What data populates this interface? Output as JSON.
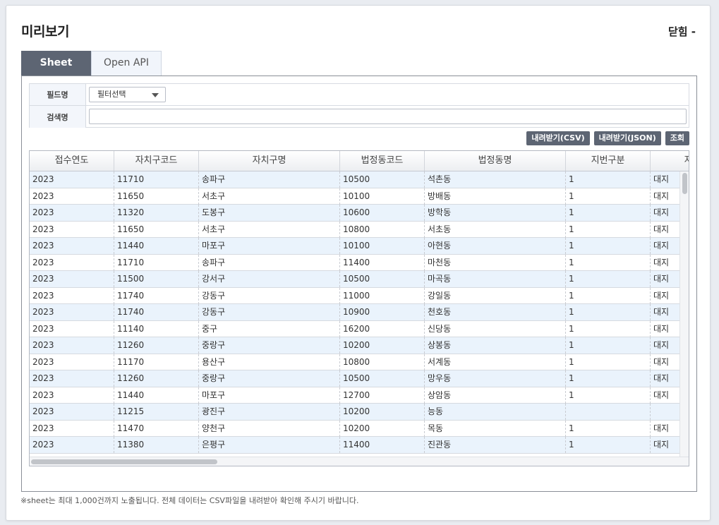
{
  "header": {
    "title": "미리보기",
    "close_label": "닫힘 -"
  },
  "tabs": [
    {
      "label": "Sheet",
      "active": true
    },
    {
      "label": "Open API",
      "active": false
    }
  ],
  "filter": {
    "field_label": "필드명",
    "field_select_value": "필터선택",
    "search_label": "검색명",
    "search_value": ""
  },
  "actions": {
    "csv_label": "내려받기(CSV)",
    "json_label": "내려받기(JSON)",
    "query_label": "조회"
  },
  "grid": {
    "columns": [
      "접수연도",
      "자치구코드",
      "자치구명",
      "법정동코드",
      "법정동명",
      "지번구분",
      "지번"
    ],
    "rows": [
      [
        "2023",
        "11710",
        "송파구",
        "10500",
        "석촌동",
        "1",
        "대지"
      ],
      [
        "2023",
        "11650",
        "서초구",
        "10100",
        "방배동",
        "1",
        "대지"
      ],
      [
        "2023",
        "11320",
        "도봉구",
        "10600",
        "방학동",
        "1",
        "대지"
      ],
      [
        "2023",
        "11650",
        "서초구",
        "10800",
        "서초동",
        "1",
        "대지"
      ],
      [
        "2023",
        "11440",
        "마포구",
        "10100",
        "아현동",
        "1",
        "대지"
      ],
      [
        "2023",
        "11710",
        "송파구",
        "11400",
        "마천동",
        "1",
        "대지"
      ],
      [
        "2023",
        "11500",
        "강서구",
        "10500",
        "마곡동",
        "1",
        "대지"
      ],
      [
        "2023",
        "11740",
        "강동구",
        "11000",
        "강일동",
        "1",
        "대지"
      ],
      [
        "2023",
        "11740",
        "강동구",
        "10900",
        "천호동",
        "1",
        "대지"
      ],
      [
        "2023",
        "11140",
        "중구",
        "16200",
        "신당동",
        "1",
        "대지"
      ],
      [
        "2023",
        "11260",
        "중랑구",
        "10200",
        "상봉동",
        "1",
        "대지"
      ],
      [
        "2023",
        "11170",
        "용산구",
        "10800",
        "서계동",
        "1",
        "대지"
      ],
      [
        "2023",
        "11260",
        "중랑구",
        "10500",
        "망우동",
        "1",
        "대지"
      ],
      [
        "2023",
        "11440",
        "마포구",
        "12700",
        "상암동",
        "1",
        "대지"
      ],
      [
        "2023",
        "11215",
        "광진구",
        "10200",
        "능동",
        "",
        ""
      ],
      [
        "2023",
        "11470",
        "양천구",
        "10200",
        "목동",
        "1",
        "대지"
      ],
      [
        "2023",
        "11380",
        "은평구",
        "11400",
        "진관동",
        "1",
        "대지"
      ]
    ]
  },
  "footer_note": "※sheet는 최대 1,000건까지 노출됩니다. 전체 데이터는 CSV파일을 내려받아 확인해 주시기 바랍니다."
}
